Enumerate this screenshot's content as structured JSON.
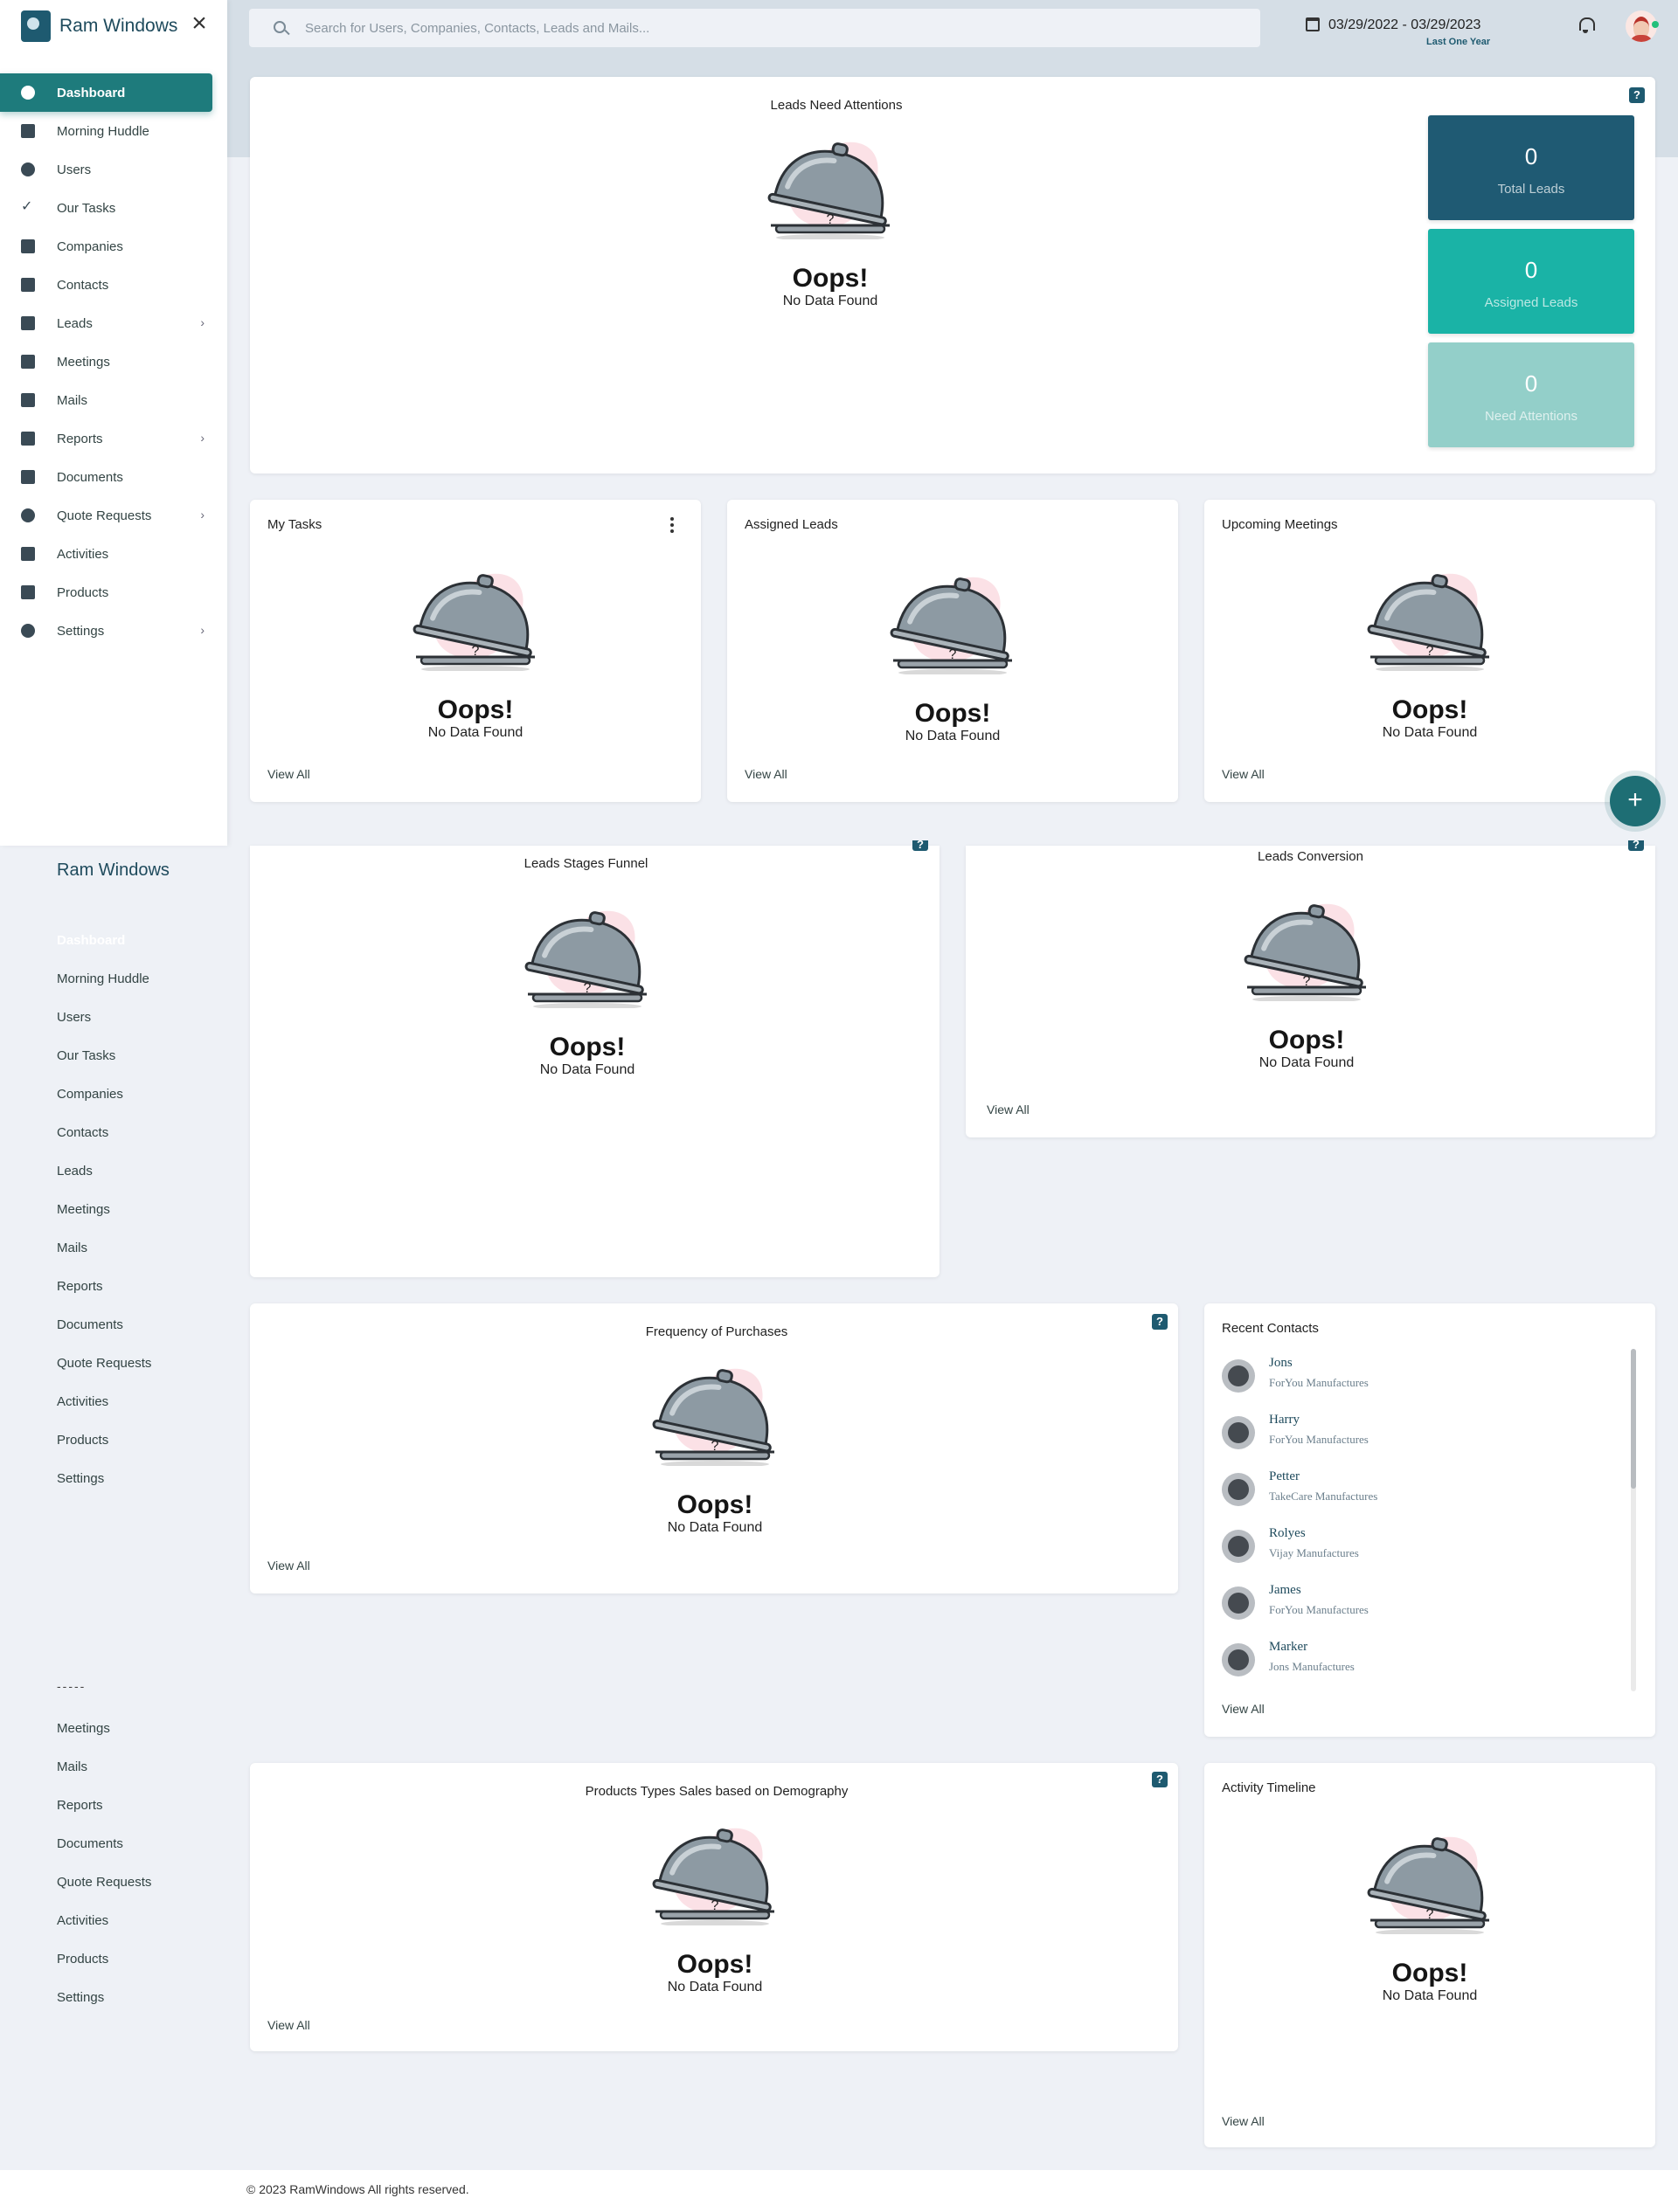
{
  "app": {
    "name": "Ram Windows",
    "footer": "© 2023 RamWindows All rights reserved."
  },
  "colors": {
    "accent": "#1e7b7c",
    "brand": "#1e5a70",
    "total_leads": "#1f5a73",
    "assigned_leads": "#1ab3a6",
    "need_attentions": "#93cfc9"
  },
  "search": {
    "placeholder": "Search for Users, Companies, Contacts, Leads and Mails..."
  },
  "header": {
    "date_range": "03/29/2022 - 03/29/2023",
    "range_label": "Last One Year"
  },
  "sidebar": {
    "items": [
      {
        "label": "Dashboard",
        "icon": "dashboard-icon",
        "active": true
      },
      {
        "label": "Morning Huddle",
        "icon": "coffee-icon"
      },
      {
        "label": "Users",
        "icon": "users-icon"
      },
      {
        "label": "Our Tasks",
        "icon": "check-icon"
      },
      {
        "label": "Companies",
        "icon": "building-icon"
      },
      {
        "label": "Contacts",
        "icon": "contact-card-icon"
      },
      {
        "label": "Leads",
        "icon": "badge-icon",
        "has_submenu": true
      },
      {
        "label": "Meetings",
        "icon": "calendar-icon"
      },
      {
        "label": "Mails",
        "icon": "mail-icon"
      },
      {
        "label": "Reports",
        "icon": "report-icon",
        "has_submenu": true
      },
      {
        "label": "Documents",
        "icon": "clipboard-icon"
      },
      {
        "label": "Quote Requests",
        "icon": "group-icon",
        "has_submenu": true
      },
      {
        "label": "Activities",
        "icon": "clipboard-icon"
      },
      {
        "label": "Products",
        "icon": "list-icon"
      },
      {
        "label": "Settings",
        "icon": "gear-icon",
        "has_submenu": true
      }
    ]
  },
  "ghost_menu": {
    "brand": "Ram Windows",
    "items_a": [
      "Dashboard",
      "Morning Huddle",
      "Users",
      "Our Tasks",
      "Companies",
      "Contacts",
      "Leads",
      "Meetings",
      "Mails",
      "Reports",
      "Documents",
      "Quote Requests",
      "Activities",
      "Products",
      "Settings"
    ],
    "dash": "-----",
    "items_b": [
      "Meetings",
      "Mails",
      "Reports",
      "Documents",
      "Quote Requests",
      "Activities",
      "Products",
      "Settings"
    ]
  },
  "empty_state": {
    "title": "Oops!",
    "subtitle": "No Data Found",
    "mark": "?",
    "help": "?"
  },
  "view_all": "View All",
  "widgets": {
    "leads_need_attentions": {
      "title": "Leads Need Attentions"
    },
    "my_tasks": {
      "title": "My Tasks"
    },
    "assigned_leads": {
      "title": "Assigned Leads"
    },
    "upcoming_meetings": {
      "title": "Upcoming Meetings"
    },
    "leads_stages_funnel": {
      "title": "Leads Stages Funnel"
    },
    "leads_conversion": {
      "title": "Leads Conversion"
    },
    "frequency_of_purchases": {
      "title": "Frequency of Purchases"
    },
    "recent_contacts": {
      "title": "Recent Contacts"
    },
    "products_types_sales": {
      "title": "Products Types Sales based on Demography"
    },
    "activity_timeline": {
      "title": "Activity Timeline"
    }
  },
  "stats": [
    {
      "value": "0",
      "label": "Total Leads"
    },
    {
      "value": "0",
      "label": "Assigned Leads"
    },
    {
      "value": "0",
      "label": "Need Attentions"
    }
  ],
  "recent_contacts": [
    {
      "name": "Jons",
      "company": "ForYou Manufactures"
    },
    {
      "name": "Harry",
      "company": "ForYou Manufactures"
    },
    {
      "name": "Petter",
      "company": "TakeCare Manufactures"
    },
    {
      "name": "Rolyes",
      "company": "Vijay Manufactures"
    },
    {
      "name": "James",
      "company": "ForYou Manufactures"
    },
    {
      "name": "Marker",
      "company": "Jons Manufactures"
    }
  ],
  "fab": "+"
}
